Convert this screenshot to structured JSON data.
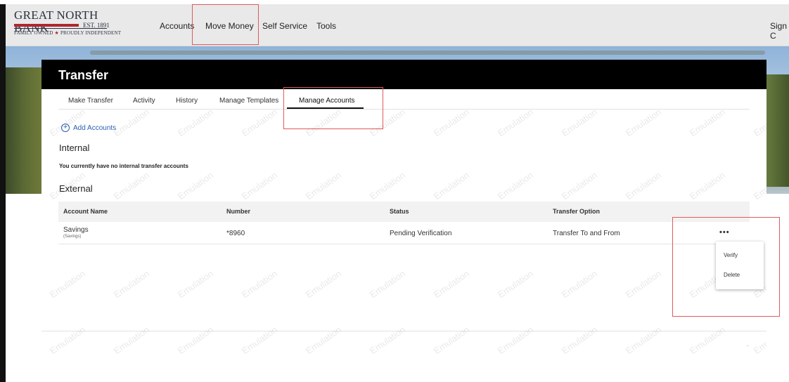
{
  "brand": {
    "name": "GREAT NORTH BANK",
    "est": "EST. 1891",
    "tagline_left": "FAMILY OWNED",
    "tagline_right": "PROUDLY INDEPENDENT",
    "star": "★",
    "colors": {
      "navy": "#2a3240",
      "red": "#b0262f"
    }
  },
  "nav": {
    "accounts": "Accounts",
    "move_money": "Move Money",
    "self_service": "Self Service",
    "tools": "Tools",
    "sign": "Sign C"
  },
  "page": {
    "title": "Transfer"
  },
  "tabs": {
    "make_transfer": "Make Transfer",
    "activity": "Activity",
    "history": "History",
    "manage_templates": "Manage Templates",
    "manage_accounts": "Manage Accounts",
    "active": "Manage Accounts"
  },
  "add_accounts": {
    "icon": "plus-circle-icon",
    "glyph": "+",
    "label": "Add Accounts"
  },
  "internal": {
    "heading": "Internal",
    "empty_message": "You currently have no internal transfer accounts"
  },
  "external": {
    "heading": "External",
    "columns": {
      "account_name": "Account Name",
      "number": "Number",
      "status": "Status",
      "transfer_option": "Transfer Option"
    },
    "rows": [
      {
        "account_name": "Savings",
        "account_type": "(Savings)",
        "number": "*8960",
        "status": "Pending Verification",
        "transfer_option": "Transfer To and From",
        "actions_glyph": "•••"
      }
    ]
  },
  "row_menu": {
    "verify": "Verify",
    "delete": "Delete"
  },
  "watermark_text": "Emulation",
  "footer_dot": ".",
  "annotation_color": "#e05a5a"
}
